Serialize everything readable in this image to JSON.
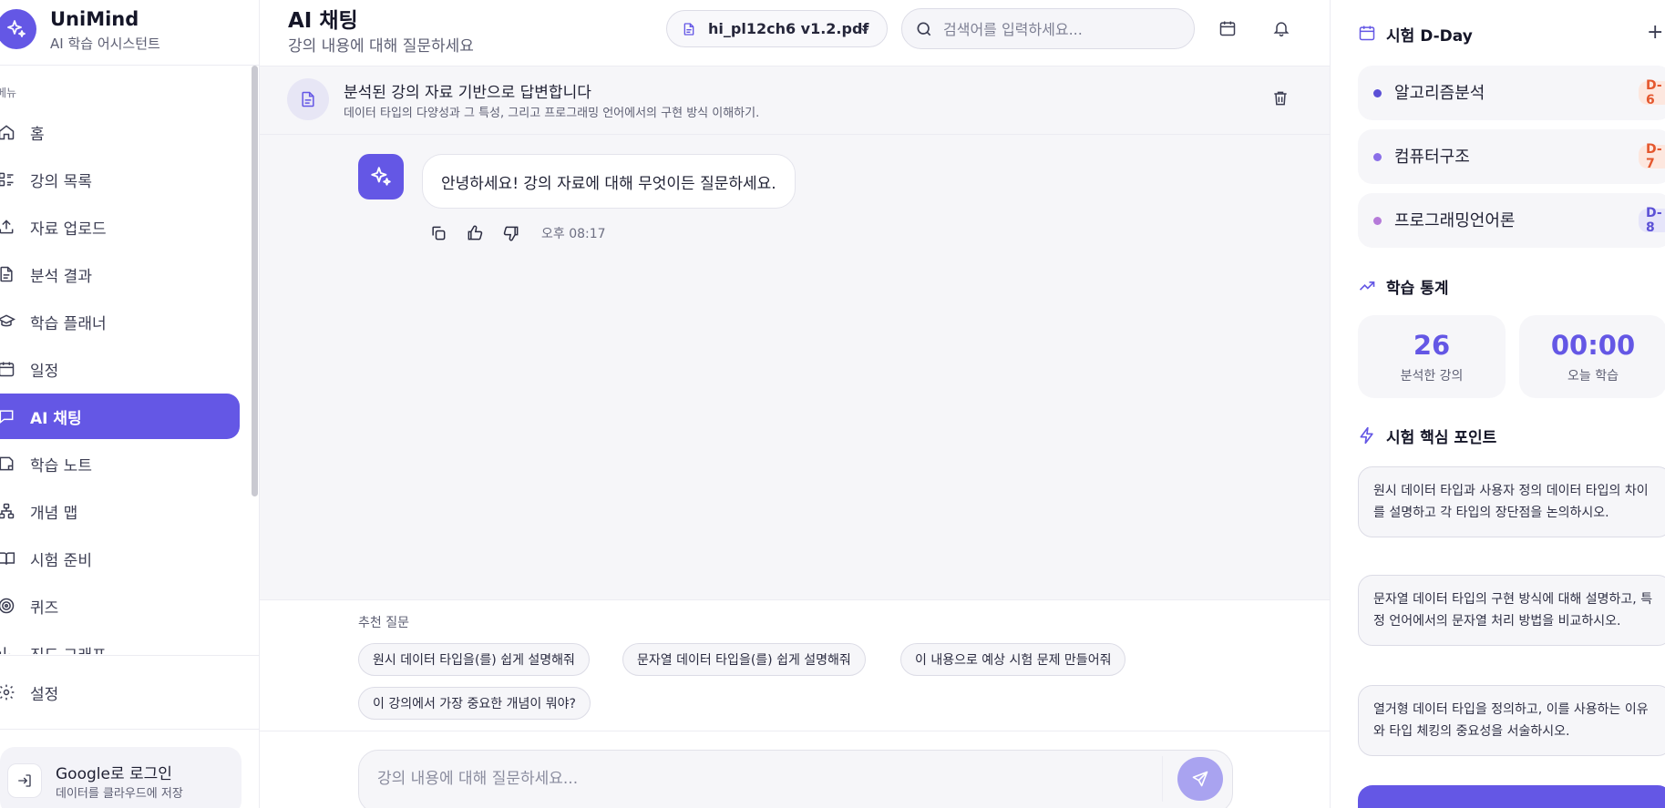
{
  "brand": {
    "name": "UniMind",
    "subtitle": "AI 학습 어시스턴트"
  },
  "menu_heading": "메뉴",
  "menu": [
    {
      "label": "홈",
      "icon": "home-icon"
    },
    {
      "label": "강의 목록",
      "icon": "list-icon"
    },
    {
      "label": "자료 업로드",
      "icon": "upload-icon"
    },
    {
      "label": "분석 결과",
      "icon": "document-icon"
    },
    {
      "label": "학습 플래너",
      "icon": "graduation-cap-icon"
    },
    {
      "label": "일정",
      "icon": "calendar-icon"
    },
    {
      "label": "AI 채팅",
      "icon": "chat-icon",
      "active": true
    },
    {
      "label": "학습 노트",
      "icon": "note-icon"
    },
    {
      "label": "개념 맵",
      "icon": "concept-map-icon"
    },
    {
      "label": "시험 준비",
      "icon": "book-open-icon"
    },
    {
      "label": "퀴즈",
      "icon": "target-icon"
    },
    {
      "label": "진도 그래프",
      "icon": "chart-icon"
    }
  ],
  "settings_label": "설정",
  "login": {
    "title": "Google로 로그인",
    "subtitle": "데이터를 클라우드에 저장"
  },
  "header": {
    "title": "AI 채팅",
    "subtitle": "강의 내용에 대해 질문하세요",
    "file": "hi_pl12ch6 v1.2.pdf",
    "search_placeholder": "검색어를 입력하세요..."
  },
  "context": {
    "title": "분석된 강의 자료 기반으로 답변합니다",
    "description": "데이터 타입의 다양성과 그 특성, 그리고 프로그래밍 언어에서의 구현 방식 이해하기."
  },
  "chat": {
    "message": "안녕하세요! 강의 자료에 대해 무엇이든 질문하세요.",
    "time": "오후 08:17"
  },
  "suggestions": {
    "label": "추천 질문",
    "items": [
      "원시 데이터 타입을(를) 쉽게 설명해줘",
      "문자열 데이터 타입을(를) 쉽게 설명해줘",
      "이 내용으로 예상 시험 문제 만들어줘",
      "이 강의에서 가장 중요한 개념이 뭐야?"
    ]
  },
  "composer": {
    "placeholder": "강의 내용에 대해 질문하세요..."
  },
  "right_panel": {
    "dday_title": "시험 D-Day",
    "add_label": "+",
    "exams": [
      {
        "name": "알고리즘분석",
        "badge": "D-6",
        "dot": "#5b50d6",
        "badge_bg": "#fde7df",
        "badge_fg": "#e4572e"
      },
      {
        "name": "컴퓨터구조",
        "badge": "D-7",
        "dot": "#8a6ee8",
        "badge_bg": "#fde7df",
        "badge_fg": "#e4572e"
      },
      {
        "name": "프로그래밍언어론",
        "badge": "D-8",
        "dot": "#b57ad9",
        "badge_bg": "#e6e5fa",
        "badge_fg": "#5b50d6"
      }
    ],
    "stats_title": "학습 통계",
    "stats": [
      {
        "value": "26",
        "label": "분석한 강의"
      },
      {
        "value": "00:00",
        "label": "오늘 학습"
      }
    ],
    "key_points_title": "시험 핵심 포인트",
    "key_points": [
      "원시 데이터 타입과 사용자 정의 데이터 타입의 차이를 설명하고 각 타입의 장단점을 논의하시오.",
      "문자열 데이터 타입의 구현 방식에 대해 설명하고, 특정 언어에서의 문자열 처리 방법을 비교하시오.",
      "열거형 데이터 타입을 정의하고, 이를 사용하는 이유와 타입 체킹의 중요성을 서술하시오."
    ]
  },
  "colors": {
    "accent": "#6457e5",
    "accent_light": "#a9a3f0",
    "surface": "#f6f6f9"
  }
}
